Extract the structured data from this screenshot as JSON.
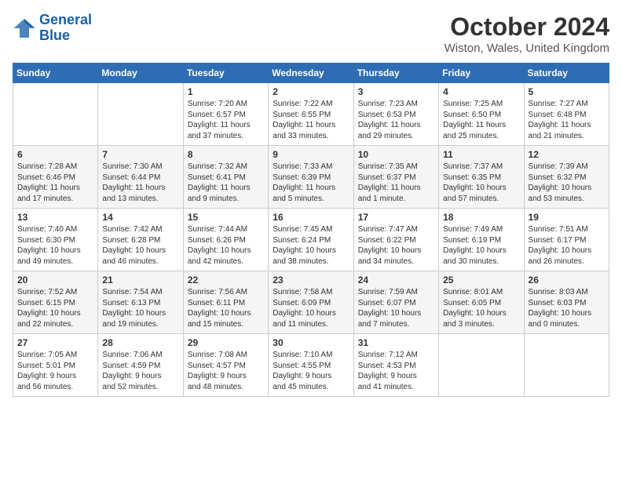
{
  "logo": {
    "line1": "General",
    "line2": "Blue"
  },
  "header": {
    "title": "October 2024",
    "subtitle": "Wiston, Wales, United Kingdom"
  },
  "days_of_week": [
    "Sunday",
    "Monday",
    "Tuesday",
    "Wednesday",
    "Thursday",
    "Friday",
    "Saturday"
  ],
  "weeks": [
    [
      {
        "day": "",
        "info": ""
      },
      {
        "day": "",
        "info": ""
      },
      {
        "day": "1",
        "info": "Sunrise: 7:20 AM\nSunset: 6:57 PM\nDaylight: 11 hours\nand 37 minutes."
      },
      {
        "day": "2",
        "info": "Sunrise: 7:22 AM\nSunset: 6:55 PM\nDaylight: 11 hours\nand 33 minutes."
      },
      {
        "day": "3",
        "info": "Sunrise: 7:23 AM\nSunset: 6:53 PM\nDaylight: 11 hours\nand 29 minutes."
      },
      {
        "day": "4",
        "info": "Sunrise: 7:25 AM\nSunset: 6:50 PM\nDaylight: 11 hours\nand 25 minutes."
      },
      {
        "day": "5",
        "info": "Sunrise: 7:27 AM\nSunset: 6:48 PM\nDaylight: 11 hours\nand 21 minutes."
      }
    ],
    [
      {
        "day": "6",
        "info": "Sunrise: 7:28 AM\nSunset: 6:46 PM\nDaylight: 11 hours\nand 17 minutes."
      },
      {
        "day": "7",
        "info": "Sunrise: 7:30 AM\nSunset: 6:44 PM\nDaylight: 11 hours\nand 13 minutes."
      },
      {
        "day": "8",
        "info": "Sunrise: 7:32 AM\nSunset: 6:41 PM\nDaylight: 11 hours\nand 9 minutes."
      },
      {
        "day": "9",
        "info": "Sunrise: 7:33 AM\nSunset: 6:39 PM\nDaylight: 11 hours\nand 5 minutes."
      },
      {
        "day": "10",
        "info": "Sunrise: 7:35 AM\nSunset: 6:37 PM\nDaylight: 11 hours\nand 1 minute."
      },
      {
        "day": "11",
        "info": "Sunrise: 7:37 AM\nSunset: 6:35 PM\nDaylight: 10 hours\nand 57 minutes."
      },
      {
        "day": "12",
        "info": "Sunrise: 7:39 AM\nSunset: 6:32 PM\nDaylight: 10 hours\nand 53 minutes."
      }
    ],
    [
      {
        "day": "13",
        "info": "Sunrise: 7:40 AM\nSunset: 6:30 PM\nDaylight: 10 hours\nand 49 minutes."
      },
      {
        "day": "14",
        "info": "Sunrise: 7:42 AM\nSunset: 6:28 PM\nDaylight: 10 hours\nand 46 minutes."
      },
      {
        "day": "15",
        "info": "Sunrise: 7:44 AM\nSunset: 6:26 PM\nDaylight: 10 hours\nand 42 minutes."
      },
      {
        "day": "16",
        "info": "Sunrise: 7:45 AM\nSunset: 6:24 PM\nDaylight: 10 hours\nand 38 minutes."
      },
      {
        "day": "17",
        "info": "Sunrise: 7:47 AM\nSunset: 6:22 PM\nDaylight: 10 hours\nand 34 minutes."
      },
      {
        "day": "18",
        "info": "Sunrise: 7:49 AM\nSunset: 6:19 PM\nDaylight: 10 hours\nand 30 minutes."
      },
      {
        "day": "19",
        "info": "Sunrise: 7:51 AM\nSunset: 6:17 PM\nDaylight: 10 hours\nand 26 minutes."
      }
    ],
    [
      {
        "day": "20",
        "info": "Sunrise: 7:52 AM\nSunset: 6:15 PM\nDaylight: 10 hours\nand 22 minutes."
      },
      {
        "day": "21",
        "info": "Sunrise: 7:54 AM\nSunset: 6:13 PM\nDaylight: 10 hours\nand 19 minutes."
      },
      {
        "day": "22",
        "info": "Sunrise: 7:56 AM\nSunset: 6:11 PM\nDaylight: 10 hours\nand 15 minutes."
      },
      {
        "day": "23",
        "info": "Sunrise: 7:58 AM\nSunset: 6:09 PM\nDaylight: 10 hours\nand 11 minutes."
      },
      {
        "day": "24",
        "info": "Sunrise: 7:59 AM\nSunset: 6:07 PM\nDaylight: 10 hours\nand 7 minutes."
      },
      {
        "day": "25",
        "info": "Sunrise: 8:01 AM\nSunset: 6:05 PM\nDaylight: 10 hours\nand 3 minutes."
      },
      {
        "day": "26",
        "info": "Sunrise: 8:03 AM\nSunset: 6:03 PM\nDaylight: 10 hours\nand 0 minutes."
      }
    ],
    [
      {
        "day": "27",
        "info": "Sunrise: 7:05 AM\nSunset: 5:01 PM\nDaylight: 9 hours\nand 56 minutes."
      },
      {
        "day": "28",
        "info": "Sunrise: 7:06 AM\nSunset: 4:59 PM\nDaylight: 9 hours\nand 52 minutes."
      },
      {
        "day": "29",
        "info": "Sunrise: 7:08 AM\nSunset: 4:57 PM\nDaylight: 9 hours\nand 48 minutes."
      },
      {
        "day": "30",
        "info": "Sunrise: 7:10 AM\nSunset: 4:55 PM\nDaylight: 9 hours\nand 45 minutes."
      },
      {
        "day": "31",
        "info": "Sunrise: 7:12 AM\nSunset: 4:53 PM\nDaylight: 9 hours\nand 41 minutes."
      },
      {
        "day": "",
        "info": ""
      },
      {
        "day": "",
        "info": ""
      }
    ]
  ]
}
